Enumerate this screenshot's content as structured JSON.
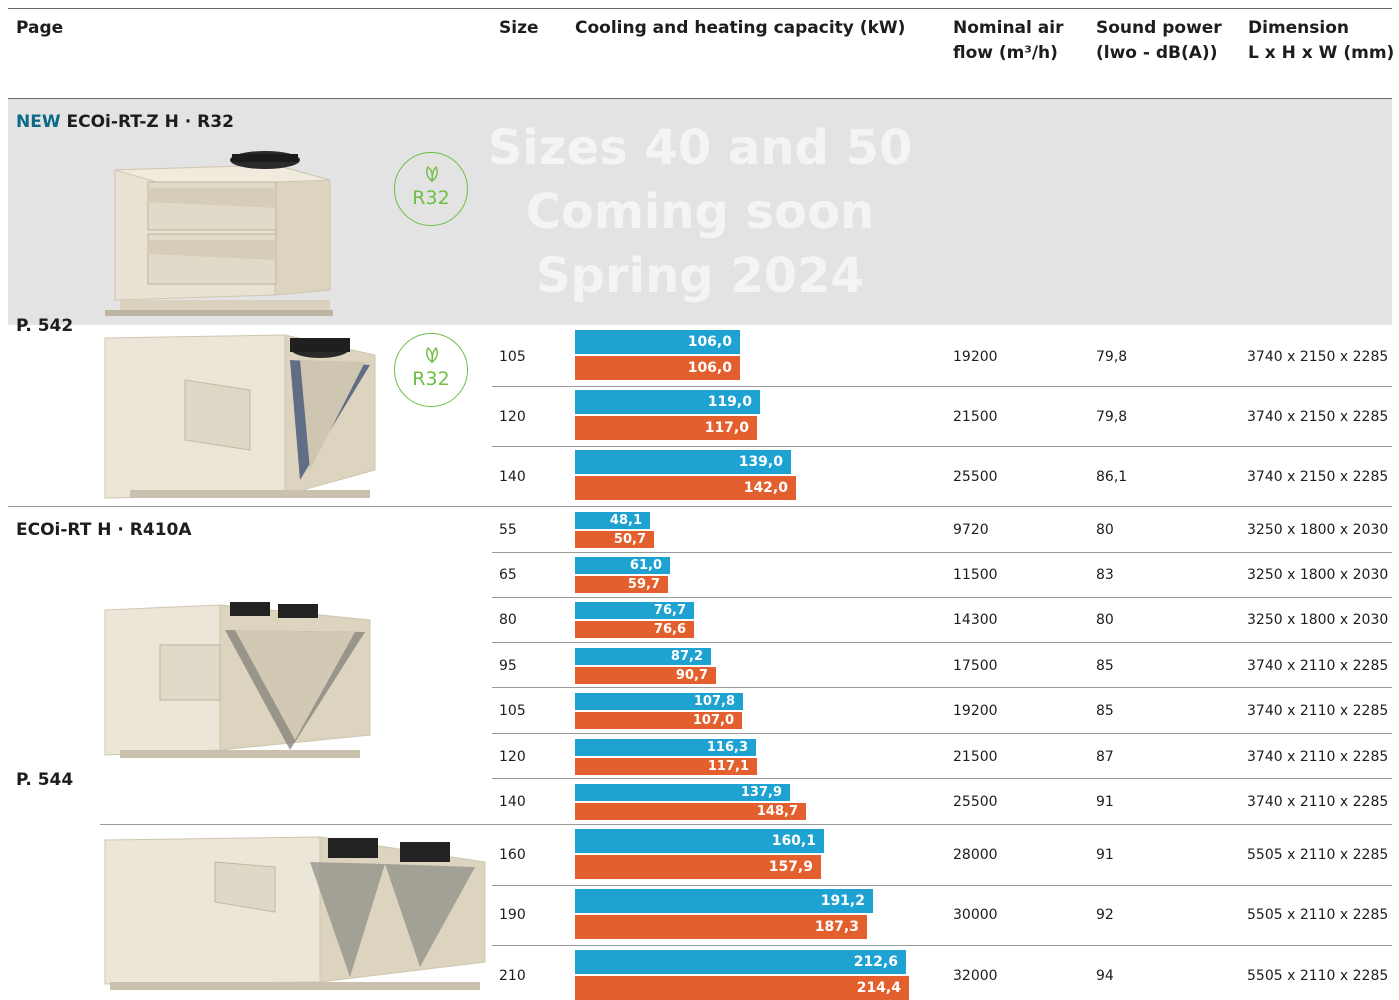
{
  "header": {
    "page": "Page",
    "size": "Size",
    "capacity": "Cooling and heating capacity (kW)",
    "airflow_l1": "Nominal air",
    "airflow_l2": "flow (m³/h)",
    "sound_l1": "Sound power",
    "sound_l2": "(lwo - dB(A))",
    "dim_l1": "Dimension",
    "dim_l2": "L x H x W (mm)"
  },
  "colors": {
    "cooling": "#1ea2d2",
    "heating": "#e3602e",
    "r32_badge": "#6fbe44",
    "new_label": "#0c6a8a"
  },
  "section1": {
    "new_label": "NEW",
    "title": "ECOi-RT-Z H · R32",
    "coming_soon_l1": "Sizes 40 and 50",
    "coming_soon_l2": "Coming soon",
    "coming_soon_l3": "Spring 2024",
    "page_ref": "P. 542",
    "badge_text": "R32",
    "badge_icon": "leaf-icon"
  },
  "section2": {
    "title": "ECOi-RT H · R410A",
    "page_ref": "P. 544"
  },
  "rows": [
    {
      "size": "105",
      "cool": "106,0",
      "heat": "106,0",
      "airflow": "19200",
      "sound": "79,8",
      "dim": "3740 x 2150 x 2285"
    },
    {
      "size": "120",
      "cool": "119,0",
      "heat": "117,0",
      "airflow": "21500",
      "sound": "79,8",
      "dim": "3740 x 2150 x 2285"
    },
    {
      "size": "140",
      "cool": "139,0",
      "heat": "142,0",
      "airflow": "25500",
      "sound": "86,1",
      "dim": "3740 x 2150 x 2285"
    },
    {
      "size": "55",
      "cool": "48,1",
      "heat": "50,7",
      "airflow": "9720",
      "sound": "80",
      "dim": "3250 x 1800 x 2030"
    },
    {
      "size": "65",
      "cool": "61,0",
      "heat": "59,7",
      "airflow": "11500",
      "sound": "83",
      "dim": "3250 x 1800 x 2030"
    },
    {
      "size": "80",
      "cool": "76,7",
      "heat": "76,6",
      "airflow": "14300",
      "sound": "80",
      "dim": "3250 x 1800 x 2030"
    },
    {
      "size": "95",
      "cool": "87,2",
      "heat": "90,7",
      "airflow": "17500",
      "sound": "85",
      "dim": "3740 x 2110 x 2285"
    },
    {
      "size": "105",
      "cool": "107,8",
      "heat": "107,0",
      "airflow": "19200",
      "sound": "85",
      "dim": "3740 x 2110 x 2285"
    },
    {
      "size": "120",
      "cool": "116,3",
      "heat": "117,1",
      "airflow": "21500",
      "sound": "87",
      "dim": "3740 x 2110 x 2285"
    },
    {
      "size": "140",
      "cool": "137,9",
      "heat": "148,7",
      "airflow": "25500",
      "sound": "91",
      "dim": "3740 x 2110 x 2285"
    },
    {
      "size": "160",
      "cool": "160,1",
      "heat": "157,9",
      "airflow": "28000",
      "sound": "91",
      "dim": "5505 x 2110 x 2285"
    },
    {
      "size": "190",
      "cool": "191,2",
      "heat": "187,3",
      "airflow": "30000",
      "sound": "92",
      "dim": "5505 x 2110 x 2285"
    },
    {
      "size": "210",
      "cool": "212,6",
      "heat": "214,4",
      "airflow": "32000",
      "sound": "94",
      "dim": "5505 x 2110 x 2285"
    }
  ]
}
